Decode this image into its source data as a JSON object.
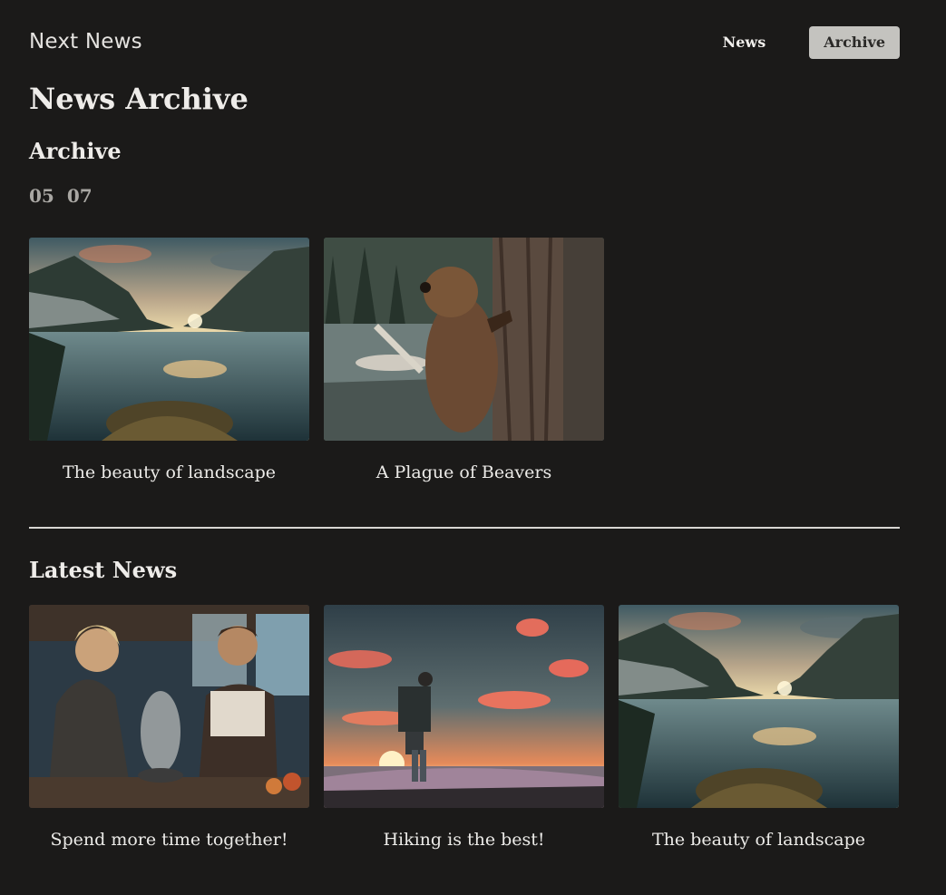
{
  "header": {
    "logo": "Next News",
    "nav": [
      {
        "label": "News",
        "active": false
      },
      {
        "label": "Archive",
        "active": true
      }
    ]
  },
  "page": {
    "title": "News Archive"
  },
  "archive": {
    "title": "Archive",
    "years": [
      "05",
      "07"
    ],
    "items": [
      {
        "title": "The beauty of landscape",
        "image": "mountain-lake-landscape"
      },
      {
        "title": "A Plague of Beavers",
        "image": "beaver-climbing-tree"
      }
    ]
  },
  "latest": {
    "title": "Latest News",
    "items": [
      {
        "title": "Spend more time together!",
        "image": "couple-cooking-kitchen"
      },
      {
        "title": "Hiking is the best!",
        "image": "hiker-sunset-clouds"
      },
      {
        "title": "The beauty of landscape",
        "image": "mountain-lake-landscape"
      }
    ]
  },
  "colors": {
    "background": "#1b1a19",
    "text": "#eeece9",
    "nav_active_bg": "#c4c3bf",
    "muted_text": "#a9a7a3"
  }
}
